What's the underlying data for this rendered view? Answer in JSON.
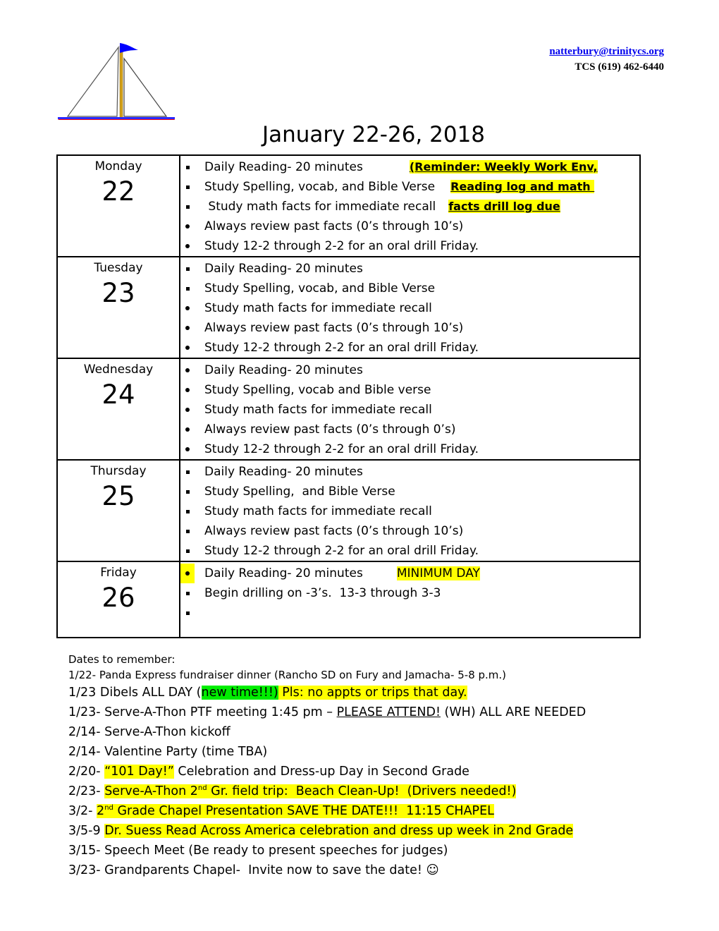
{
  "header": {
    "email": "natterbury@trinitycs.org",
    "phone": "TCS (619) 462-6440",
    "logo_icon": "sailboat-icon",
    "title": "January 22-26, 2018"
  },
  "colors": {
    "highlight_yellow": "#ffff00",
    "highlight_green": "#00ee00",
    "link_blue": "#0000ee",
    "boat_hull": "#ff0000",
    "boat_flag": "#0000ff",
    "mast": "#d4a017"
  },
  "days": [
    {
      "name": "Monday",
      "number": "22",
      "tasks": [
        {
          "bullet": "square",
          "text": "Daily Reading- 20 minutes",
          "note": "(Reminder: Weekly Work Env,"
        },
        {
          "bullet": "square",
          "text": "Study Spelling, vocab, and Bible Verse",
          "note": "Reading log and math "
        },
        {
          "bullet": "square",
          "text": " Study math facts for immediate recall",
          "note": "facts drill log due"
        },
        {
          "bullet": "dot",
          "text": "Always review past facts (0’s through 10’s)"
        },
        {
          "bullet": "dot",
          "text": "Study 12-2 through 2-2 for an oral drill Friday."
        }
      ]
    },
    {
      "name": "Tuesday",
      "number": "23",
      "tasks": [
        {
          "bullet": "square",
          "text": "Daily Reading- 20 minutes"
        },
        {
          "bullet": "square",
          "text": "Study Spelling, vocab, and Bible Verse"
        },
        {
          "bullet": "dot",
          "text": "Study math facts for immediate recall"
        },
        {
          "bullet": "dot",
          "text": "Always review past facts (0’s through 10’s)"
        },
        {
          "bullet": "dot",
          "text": "Study 12-2 through 2-2 for an oral drill Friday."
        }
      ]
    },
    {
      "name": "Wednesday",
      "number": "24",
      "tasks": [
        {
          "bullet": "dot",
          "text": "Daily Reading- 20 minutes"
        },
        {
          "bullet": "dot",
          "text": "Study Spelling, vocab and Bible verse"
        },
        {
          "bullet": "dot",
          "text": "Study math facts for immediate recall"
        },
        {
          "bullet": "dot",
          "text": "Always review past facts (0’s through 0’s)"
        },
        {
          "bullet": "dot",
          "text": "Study 12-2 through 2-2 for an oral drill Friday."
        }
      ]
    },
    {
      "name": "Thursday",
      "number": "25",
      "tasks": [
        {
          "bullet": "square",
          "text": "Daily Reading- 20 minutes"
        },
        {
          "bullet": "square",
          "text": "Study Spelling,  and Bible Verse"
        },
        {
          "bullet": "square",
          "text": "Study math facts for immediate recall"
        },
        {
          "bullet": "square",
          "text": "Always review past facts (0’s through 10’s)"
        },
        {
          "bullet": "square",
          "text": "Study 12-2 through 2-2 for an oral drill Friday."
        }
      ]
    },
    {
      "name": "Friday",
      "number": "26",
      "tasks": [
        {
          "bullet": "dot",
          "text": "Daily Reading- 20 minutes",
          "note": "MINIMUM DAY"
        },
        {
          "bullet": "square",
          "text": "Begin drilling on -3’s.  13-3 through 3-3"
        },
        {
          "bullet": "square",
          "text": ""
        }
      ]
    }
  ],
  "dates_to_remember": {
    "heading": "Dates to remember:",
    "items": [
      {
        "prefix": "1/22- Panda Express fundraiser dinner (Rancho SD on Fury and Jamacha- 5-8 p.m.)"
      },
      {
        "prefix": "1/23 Dibels ALL DAY (",
        "green": "new time!!!)",
        "yellow": " Pls: no appts or trips that day."
      },
      {
        "prefix": "1/23- Serve-A-Thon PTF meeting 1:45 pm – ",
        "underlined": "PLEASE ATTEND!",
        "suffix": " (WH) ALL ARE NEEDED"
      },
      {
        "prefix": "2/14- Serve-A-Thon kickoff"
      },
      {
        "prefix": "2/14- Valentine Party (time TBA)"
      },
      {
        "prefix": "2/20- ",
        "yellow": "“101 Day!”",
        "suffix": " Celebration and Dress-up Day in Second Grade"
      },
      {
        "prefix": "2/23- ",
        "yellow_a": "Serve-A-Thon 2",
        "sup": "nd",
        "yellow_b": " Gr. field trip:  Beach Clean-Up!  (Drivers needed!)"
      },
      {
        "prefix": "3/2- ",
        "yellow_a": "2",
        "sup": "nd",
        "yellow_b": " Grade Chapel Presentation SAVE THE DATE!!!  11:15 CHAPEL"
      },
      {
        "prefix": "3/5-9 ",
        "yellow": "Dr. Suess Read Across America celebration and dress up week in 2nd Grade"
      },
      {
        "prefix": "3/15- Speech Meet (Be ready to present speeches for judges)"
      },
      {
        "prefix": "3/23- Grandparents Chapel-  Invite now to save the date! ",
        "smiley": "☺"
      }
    ]
  }
}
